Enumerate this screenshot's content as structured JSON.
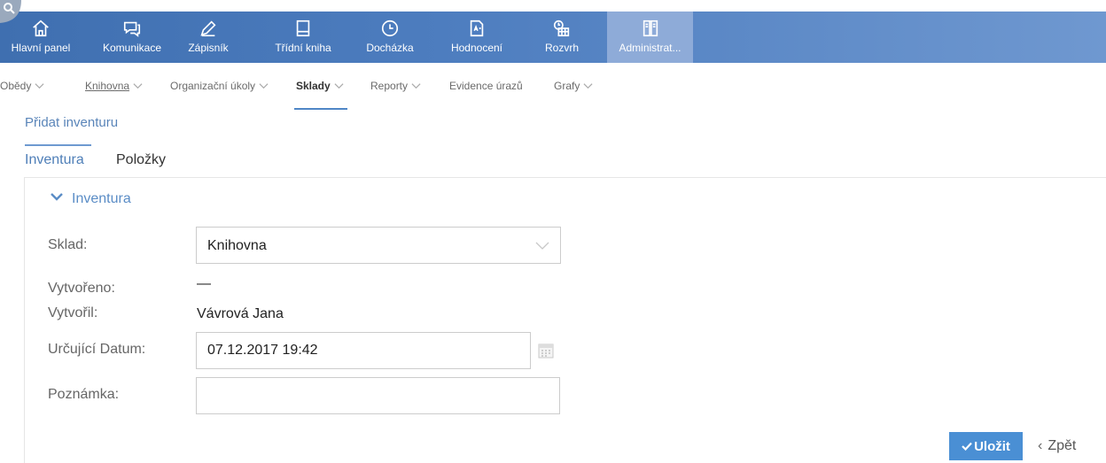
{
  "topnav": {
    "items": [
      {
        "label": "Hlavní panel",
        "icon": "home-icon"
      },
      {
        "label": "Komunikace",
        "icon": "chat-icon"
      },
      {
        "label": "Zápisník",
        "icon": "pen-icon"
      },
      {
        "label": "Třídní kniha",
        "icon": "book-icon"
      },
      {
        "label": "Docházka",
        "icon": "clock-icon"
      },
      {
        "label": "Hodnocení",
        "icon": "grade-icon"
      },
      {
        "label": "Rozvrh",
        "icon": "schedule-icon"
      },
      {
        "label": "Administrat...",
        "icon": "admin-icon"
      }
    ],
    "active_index": 7
  },
  "subnav": {
    "items": [
      {
        "label": "Obědy"
      },
      {
        "label": "Knihovna"
      },
      {
        "label": "Organizační úkoly"
      },
      {
        "label": "Sklady"
      },
      {
        "label": "Reporty"
      },
      {
        "label": "Evidence úrazů"
      },
      {
        "label": "Grafy"
      }
    ],
    "active": "Sklady"
  },
  "page": {
    "title": "Přidat inventuru",
    "tabs": [
      {
        "label": "Inventura"
      },
      {
        "label": "Položky"
      }
    ]
  },
  "form": {
    "section_title": "Inventura",
    "labels": {
      "sklad": "Sklad:",
      "vytvoreno": "Vytvořeno:",
      "vytvoril": "Vytvořil:",
      "datum": "Určující Datum:",
      "poznamka": "Poznámka:"
    },
    "values": {
      "sklad": "Knihovna",
      "vytvoreno": "—",
      "vytvoril": "Vávrová Jana",
      "datum": "07.12.2017 19:42",
      "poznamka": ""
    }
  },
  "actions": {
    "save": "Uložit",
    "back": "Zpět"
  },
  "colors": {
    "topbar": "#4d7dbf",
    "accent": "#4a8fd4",
    "active_nav": "#8eabd8"
  }
}
